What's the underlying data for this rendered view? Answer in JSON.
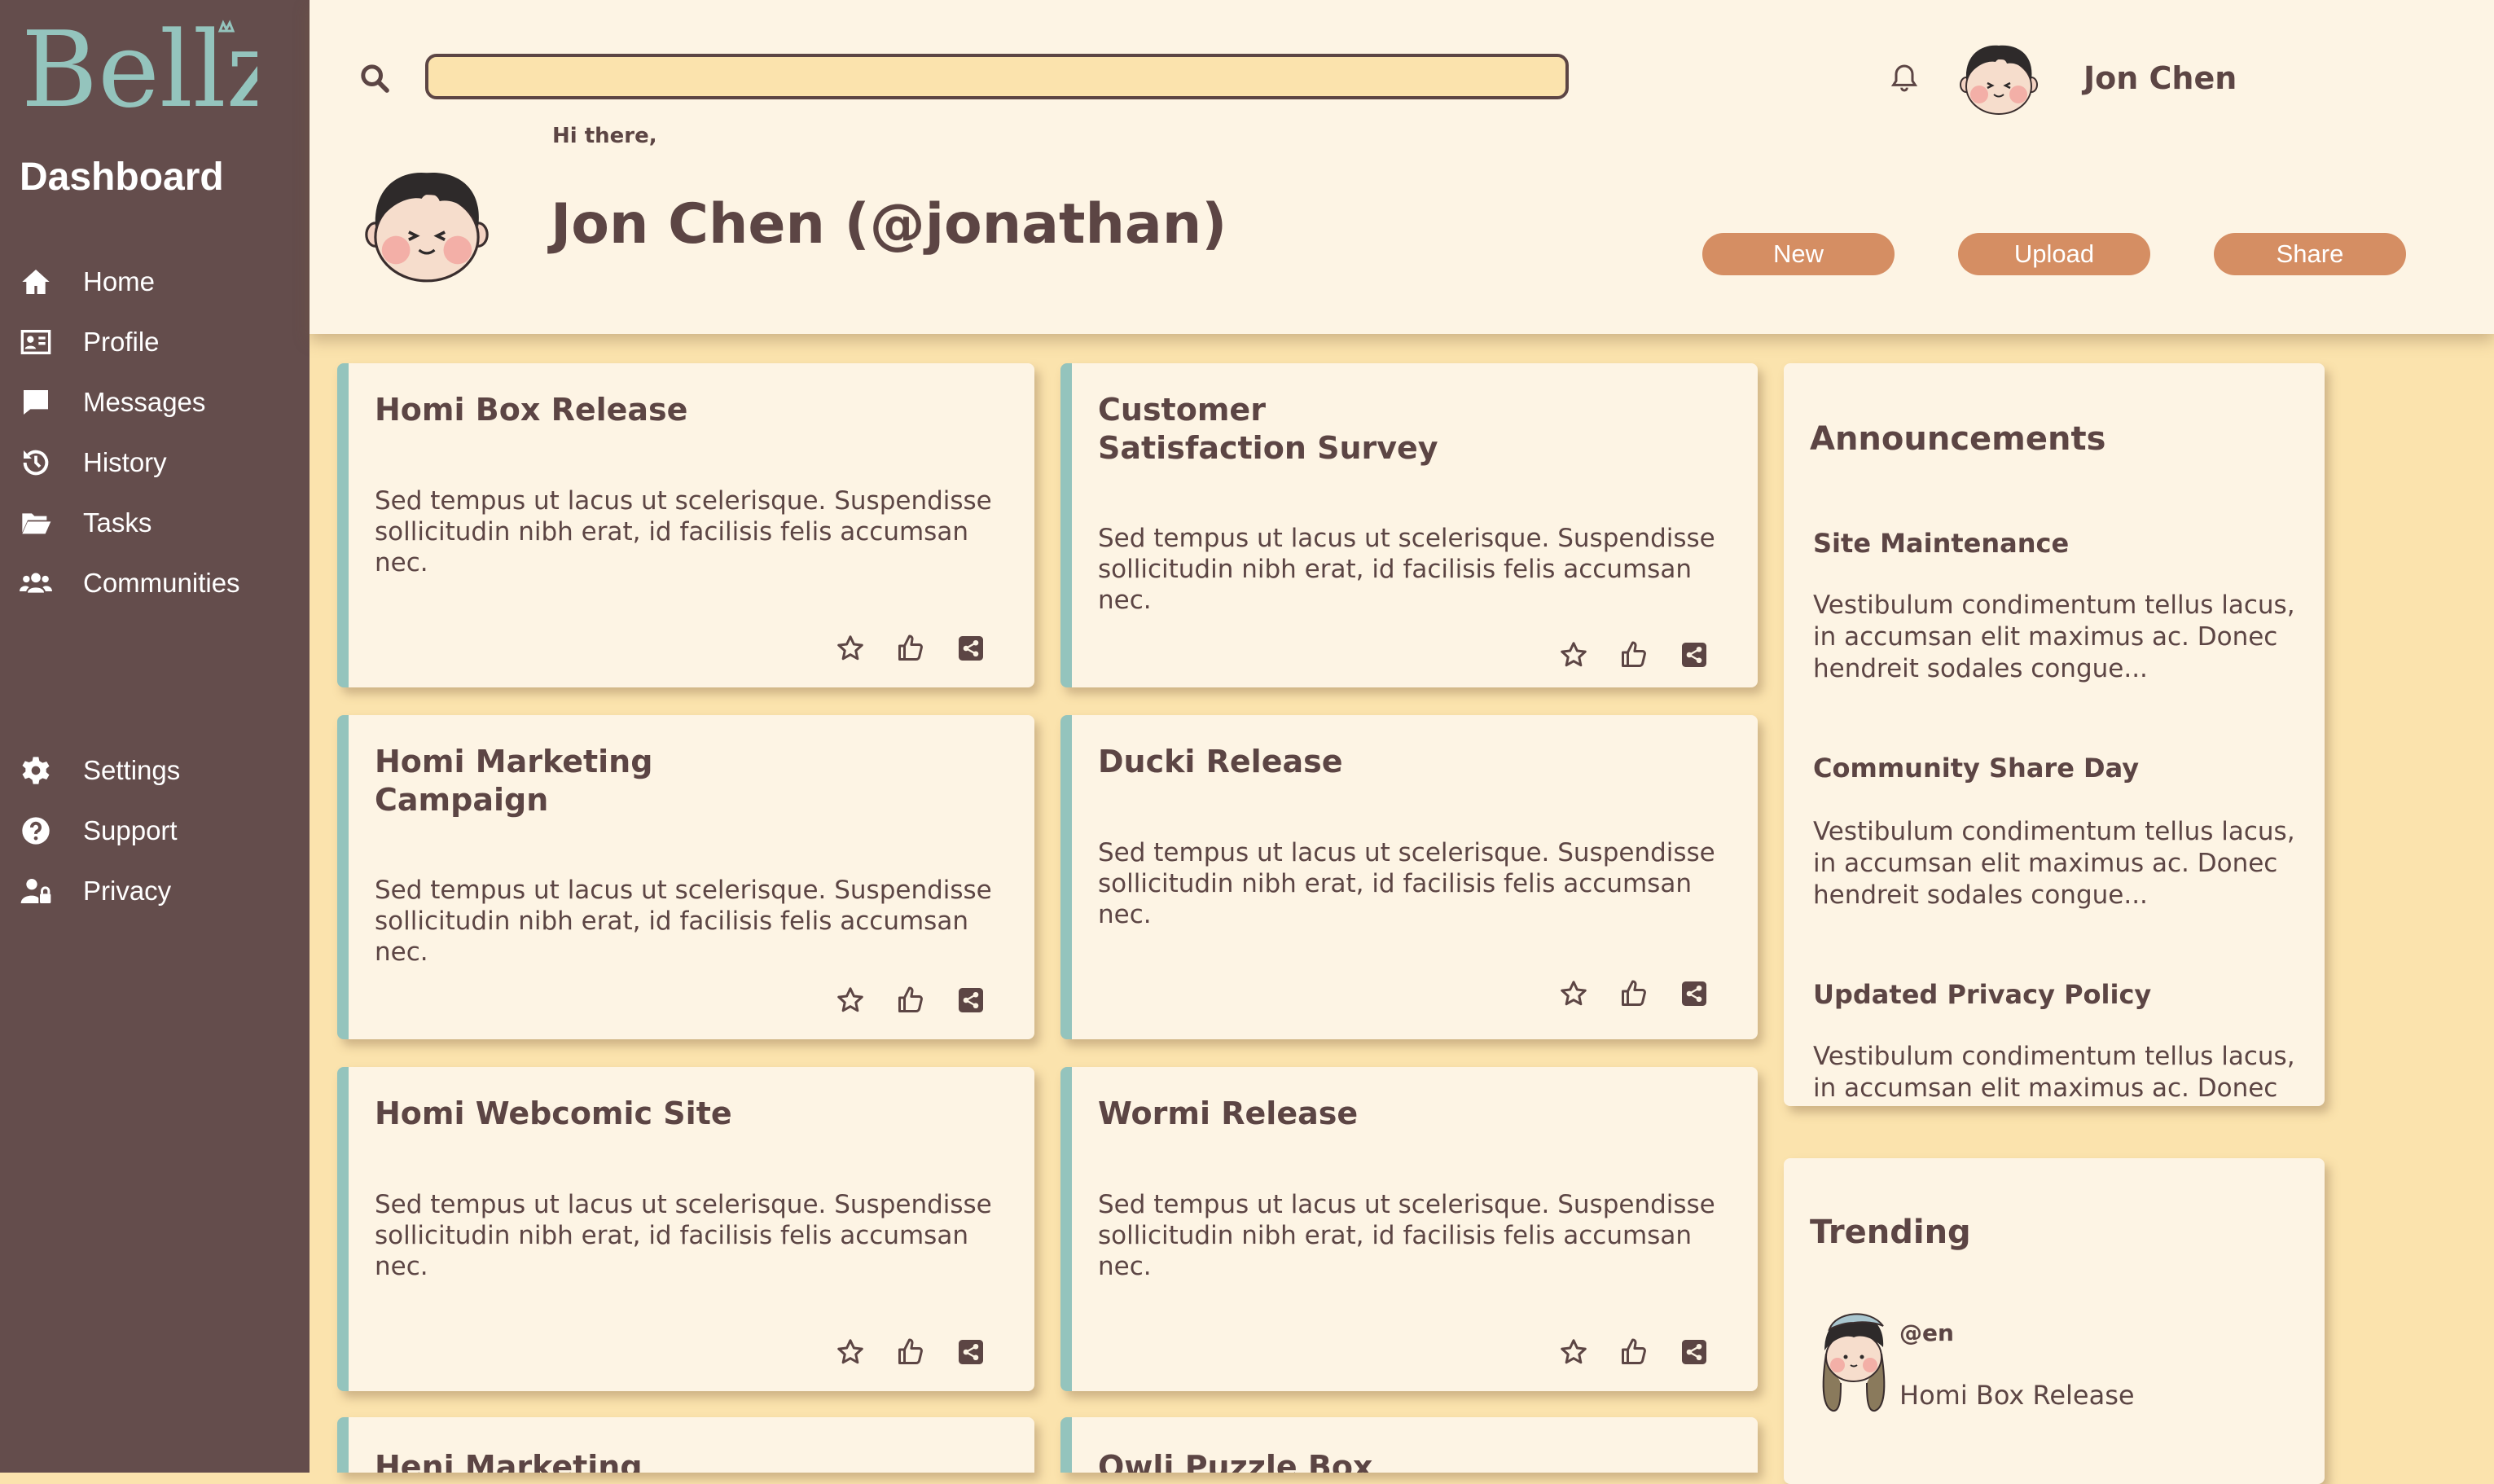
{
  "brand": {
    "logo_text": "Bellzi",
    "accent": "#94c4bd",
    "sidebar_bg": "#644d4c",
    "button_color": "#d58e63"
  },
  "sidebar": {
    "title": "Dashboard",
    "items": [
      {
        "label": "Home",
        "icon": "home-icon"
      },
      {
        "label": "Profile",
        "icon": "id-card-icon"
      },
      {
        "label": "Messages",
        "icon": "message-icon"
      },
      {
        "label": "History",
        "icon": "history-icon"
      },
      {
        "label": "Tasks",
        "icon": "folder-icon"
      },
      {
        "label": "Communities",
        "icon": "users-icon"
      }
    ],
    "bottom_items": [
      {
        "label": "Settings",
        "icon": "gear-icon"
      },
      {
        "label": "Support",
        "icon": "question-icon"
      },
      {
        "label": "Privacy",
        "icon": "user-lock-icon"
      }
    ]
  },
  "header": {
    "search_value": "",
    "username": "Jon Chen",
    "greeting": "Hi there,",
    "profile_name": "Jon Chen (@jonathan)",
    "buttons": {
      "new": "New",
      "upload": "Upload",
      "share": "Share"
    }
  },
  "cards": [
    {
      "title": "Homi Box Release",
      "body": "Sed tempus ut lacus ut scelerisque. Suspendisse sollicitudin nibh erat, id facilisis felis accumsan nec."
    },
    {
      "title": "Customer\nSatisfaction Survey",
      "body": "Sed tempus ut lacus ut scelerisque. Suspendisse sollicitudin nibh erat, id facilisis felis accumsan nec."
    },
    {
      "title": "Homi Marketing\nCampaign",
      "body": "Sed tempus ut lacus ut scelerisque. Suspendisse sollicitudin nibh erat, id facilisis felis accumsan nec."
    },
    {
      "title": "Ducki Release",
      "body": "Sed tempus ut lacus ut scelerisque. Suspendisse sollicitudin nibh erat, id facilisis felis accumsan nec."
    },
    {
      "title": "Homi Webcomic Site",
      "body": "Sed tempus ut lacus ut scelerisque. Suspendisse sollicitudin nibh erat, id facilisis felis accumsan nec."
    },
    {
      "title": "Wormi Release",
      "body": "Sed tempus ut lacus ut scelerisque. Suspendisse sollicitudin nibh erat, id facilisis felis accumsan nec."
    },
    {
      "title": "Heni Marketing",
      "body": ""
    },
    {
      "title": "Owli Puzzle Box",
      "body": ""
    }
  ],
  "announcements": {
    "title": "Announcements",
    "items": [
      {
        "title": "Site Maintenance",
        "body": "Vestibulum condimentum tellus lacus, in accumsan elit maximus ac. Donec hendreit sodales congue..."
      },
      {
        "title": "Community Share Day",
        "body": "Vestibulum condimentum tellus lacus, in accumsan elit maximus ac. Donec hendreit sodales congue..."
      },
      {
        "title": "Updated Privacy Policy",
        "body": "Vestibulum condimentum tellus lacus, in accumsan elit maximus ac. Donec"
      }
    ]
  },
  "trending": {
    "title": "Trending",
    "items": [
      {
        "handle": "@en",
        "text": "Homi Box Release"
      }
    ]
  }
}
